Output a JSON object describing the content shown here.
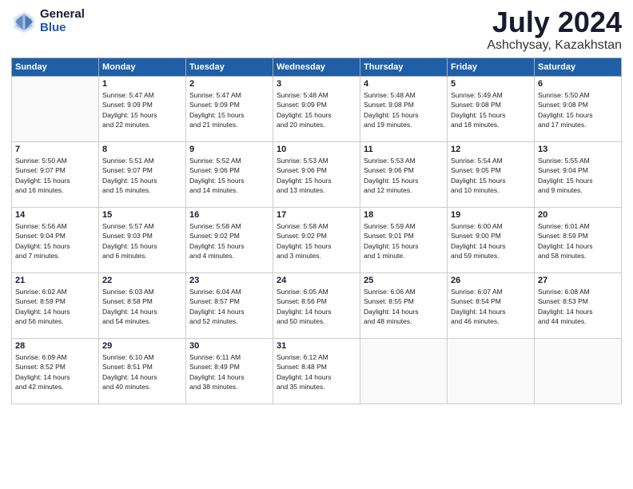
{
  "header": {
    "logo": {
      "general": "General",
      "blue": "Blue"
    },
    "title": "July 2024",
    "location": "Ashchysay, Kazakhstan"
  },
  "weekdays": [
    "Sunday",
    "Monday",
    "Tuesday",
    "Wednesday",
    "Thursday",
    "Friday",
    "Saturday"
  ],
  "weeks": [
    [
      {
        "day": "",
        "info": ""
      },
      {
        "day": "1",
        "info": "Sunrise: 5:47 AM\nSunset: 9:09 PM\nDaylight: 15 hours\nand 22 minutes."
      },
      {
        "day": "2",
        "info": "Sunrise: 5:47 AM\nSunset: 9:09 PM\nDaylight: 15 hours\nand 21 minutes."
      },
      {
        "day": "3",
        "info": "Sunrise: 5:48 AM\nSunset: 9:09 PM\nDaylight: 15 hours\nand 20 minutes."
      },
      {
        "day": "4",
        "info": "Sunrise: 5:48 AM\nSunset: 9:08 PM\nDaylight: 15 hours\nand 19 minutes."
      },
      {
        "day": "5",
        "info": "Sunrise: 5:49 AM\nSunset: 9:08 PM\nDaylight: 15 hours\nand 18 minutes."
      },
      {
        "day": "6",
        "info": "Sunrise: 5:50 AM\nSunset: 9:08 PM\nDaylight: 15 hours\nand 17 minutes."
      }
    ],
    [
      {
        "day": "7",
        "info": "Sunrise: 5:50 AM\nSunset: 9:07 PM\nDaylight: 15 hours\nand 16 minutes."
      },
      {
        "day": "8",
        "info": "Sunrise: 5:51 AM\nSunset: 9:07 PM\nDaylight: 15 hours\nand 15 minutes."
      },
      {
        "day": "9",
        "info": "Sunrise: 5:52 AM\nSunset: 9:06 PM\nDaylight: 15 hours\nand 14 minutes."
      },
      {
        "day": "10",
        "info": "Sunrise: 5:53 AM\nSunset: 9:06 PM\nDaylight: 15 hours\nand 13 minutes."
      },
      {
        "day": "11",
        "info": "Sunrise: 5:53 AM\nSunset: 9:06 PM\nDaylight: 15 hours\nand 12 minutes."
      },
      {
        "day": "12",
        "info": "Sunrise: 5:54 AM\nSunset: 9:05 PM\nDaylight: 15 hours\nand 10 minutes."
      },
      {
        "day": "13",
        "info": "Sunrise: 5:55 AM\nSunset: 9:04 PM\nDaylight: 15 hours\nand 9 minutes."
      }
    ],
    [
      {
        "day": "14",
        "info": "Sunrise: 5:56 AM\nSunset: 9:04 PM\nDaylight: 15 hours\nand 7 minutes."
      },
      {
        "day": "15",
        "info": "Sunrise: 5:57 AM\nSunset: 9:03 PM\nDaylight: 15 hours\nand 6 minutes."
      },
      {
        "day": "16",
        "info": "Sunrise: 5:58 AM\nSunset: 9:02 PM\nDaylight: 15 hours\nand 4 minutes."
      },
      {
        "day": "17",
        "info": "Sunrise: 5:58 AM\nSunset: 9:02 PM\nDaylight: 15 hours\nand 3 minutes."
      },
      {
        "day": "18",
        "info": "Sunrise: 5:59 AM\nSunset: 9:01 PM\nDaylight: 15 hours\nand 1 minute."
      },
      {
        "day": "19",
        "info": "Sunrise: 6:00 AM\nSunset: 9:00 PM\nDaylight: 14 hours\nand 59 minutes."
      },
      {
        "day": "20",
        "info": "Sunrise: 6:01 AM\nSunset: 8:59 PM\nDaylight: 14 hours\nand 58 minutes."
      }
    ],
    [
      {
        "day": "21",
        "info": "Sunrise: 6:02 AM\nSunset: 8:59 PM\nDaylight: 14 hours\nand 56 minutes."
      },
      {
        "day": "22",
        "info": "Sunrise: 6:03 AM\nSunset: 8:58 PM\nDaylight: 14 hours\nand 54 minutes."
      },
      {
        "day": "23",
        "info": "Sunrise: 6:04 AM\nSunset: 8:57 PM\nDaylight: 14 hours\nand 52 minutes."
      },
      {
        "day": "24",
        "info": "Sunrise: 6:05 AM\nSunset: 8:56 PM\nDaylight: 14 hours\nand 50 minutes."
      },
      {
        "day": "25",
        "info": "Sunrise: 6:06 AM\nSunset: 8:55 PM\nDaylight: 14 hours\nand 48 minutes."
      },
      {
        "day": "26",
        "info": "Sunrise: 6:07 AM\nSunset: 8:54 PM\nDaylight: 14 hours\nand 46 minutes."
      },
      {
        "day": "27",
        "info": "Sunrise: 6:08 AM\nSunset: 8:53 PM\nDaylight: 14 hours\nand 44 minutes."
      }
    ],
    [
      {
        "day": "28",
        "info": "Sunrise: 6:09 AM\nSunset: 8:52 PM\nDaylight: 14 hours\nand 42 minutes."
      },
      {
        "day": "29",
        "info": "Sunrise: 6:10 AM\nSunset: 8:51 PM\nDaylight: 14 hours\nand 40 minutes."
      },
      {
        "day": "30",
        "info": "Sunrise: 6:11 AM\nSunset: 8:49 PM\nDaylight: 14 hours\nand 38 minutes."
      },
      {
        "day": "31",
        "info": "Sunrise: 6:12 AM\nSunset: 8:48 PM\nDaylight: 14 hours\nand 35 minutes."
      },
      {
        "day": "",
        "info": ""
      },
      {
        "day": "",
        "info": ""
      },
      {
        "day": "",
        "info": ""
      }
    ]
  ]
}
